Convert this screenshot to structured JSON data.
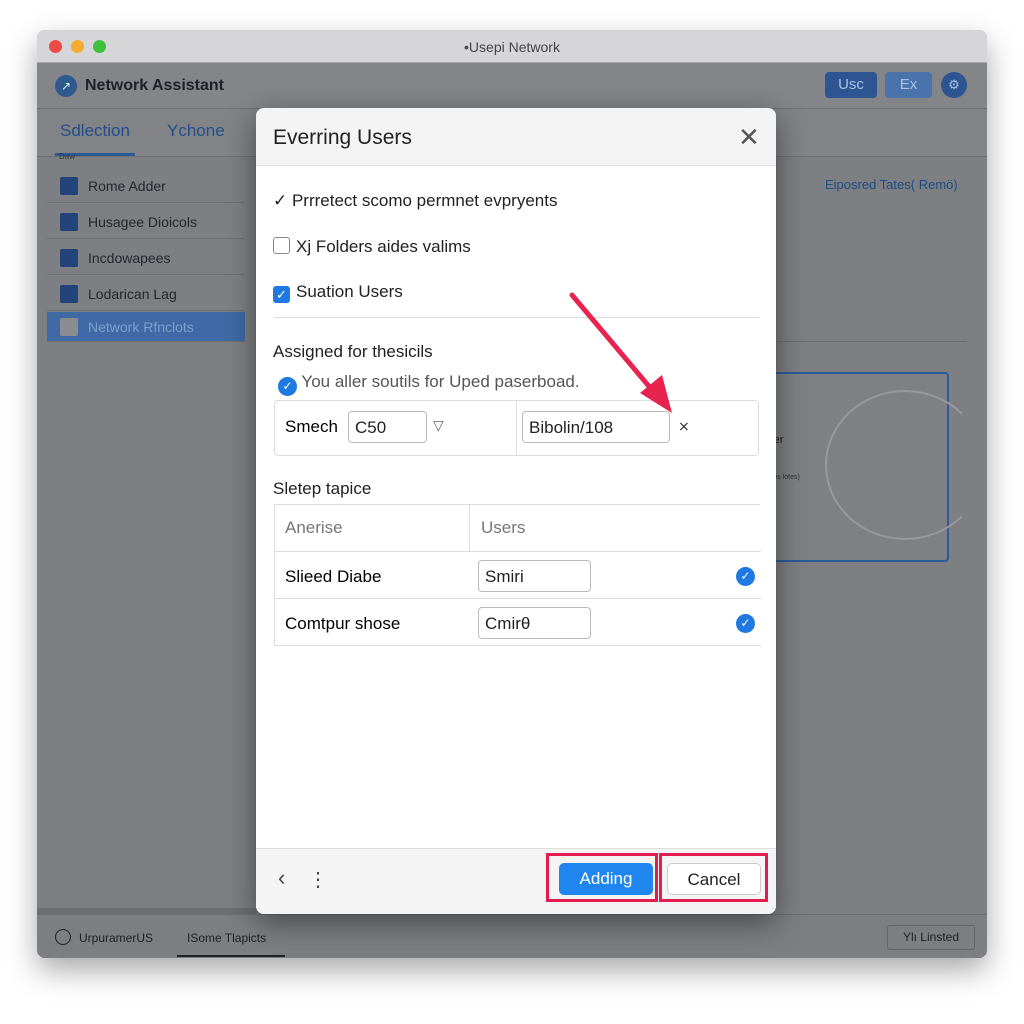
{
  "window": {
    "title": "•Usepi Network",
    "controls": [
      "close",
      "minimize",
      "maximize"
    ]
  },
  "header": {
    "title": "Network Assistant",
    "buttons": [
      "Usc",
      "Ex"
    ],
    "settings_icon": "gear-icon"
  },
  "tabs": [
    {
      "label": "Sdlection",
      "active": true
    },
    {
      "label": "Ychone",
      "active": false
    }
  ],
  "tab_sublabel": "Daw",
  "sidebar": {
    "items": [
      {
        "label": "Rome Adder",
        "icon": "camera-icon"
      },
      {
        "label": "Husagee Dioicols",
        "icon": "list-icon"
      },
      {
        "label": "Incdowapees",
        "icon": "grid-icon"
      },
      {
        "label": "Lodarican Lag",
        "icon": "window-icon"
      },
      {
        "label": "Network Rfnclots",
        "icon": "window-icon",
        "active": true
      }
    ]
  },
  "right": {
    "link": "Eiposred Tates( Remö)",
    "panel_label": "older",
    "panel_sublabel": "Bantes lotes)"
  },
  "footer": {
    "items": [
      "UrpuramerUS",
      "ISome Tlapicts"
    ],
    "button": "Ylı Linsted"
  },
  "modal": {
    "title": "Everring Users",
    "check_line": "Prrretect scomo permnet evpryents",
    "option1": {
      "label": "Xј Folders aides valims",
      "checked": false
    },
    "option2": {
      "label": "Suation Users",
      "checked": true
    },
    "section1": "Assigned for thesicils",
    "info": "You aller soutils for Uped paserboad.",
    "filter": {
      "label": "Smech",
      "select_value": "C50",
      "input_value": "Bibolin/108"
    },
    "section2": "Sletep tapice",
    "table": {
      "headers": [
        "Anerise",
        "Users"
      ],
      "rows": [
        {
          "name": "Slieed Diabe",
          "value": "Smiri",
          "checked": true
        },
        {
          "name": "Comtpur shose",
          "value": "Cmirθ",
          "checked": true
        }
      ]
    },
    "footer": {
      "primary": "Adding",
      "cancel": "Cancel"
    }
  },
  "colors": {
    "accent": "#1e7ae0",
    "highlight": "#e31c4f"
  }
}
